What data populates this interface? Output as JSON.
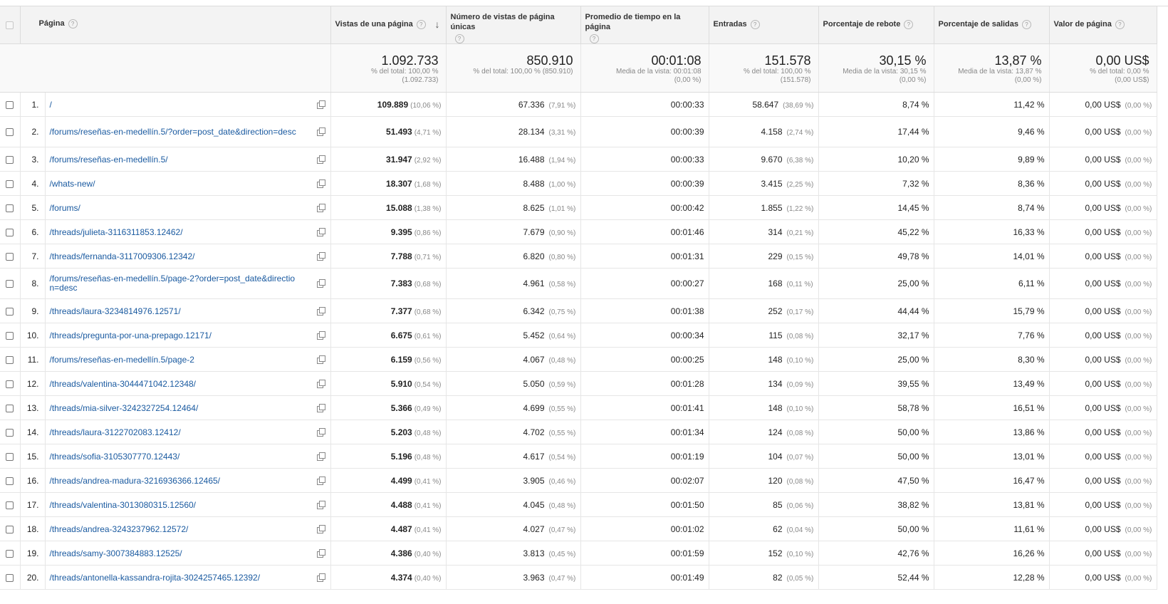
{
  "columns": {
    "pagina": "Página",
    "vistas": "Vistas de una página",
    "unicas": "Número de vistas de página únicas",
    "promedio": "Promedio de tiempo en la página",
    "entradas": "Entradas",
    "rebote": "Porcentaje de rebote",
    "salidas": "Porcentaje de salidas",
    "valor": "Valor de página",
    "help_glyph": "?",
    "sort_glyph": "↓"
  },
  "totals": {
    "vistas": {
      "value": "1.092.733",
      "sub1": "% del total: 100,00 %",
      "sub2": "(1.092.733)"
    },
    "unicas": {
      "value": "850.910",
      "sub1": "% del total: 100,00 % (850.910)",
      "sub2": ""
    },
    "promedio": {
      "value": "00:01:08",
      "sub1": "Media de la vista: 00:01:08",
      "sub2": "(0,00 %)"
    },
    "entradas": {
      "value": "151.578",
      "sub1": "% del total: 100,00 %",
      "sub2": "(151.578)"
    },
    "rebote": {
      "value": "30,15 %",
      "sub1": "Media de la vista: 30,15 %",
      "sub2": "(0,00 %)"
    },
    "salidas": {
      "value": "13,87 %",
      "sub1": "Media de la vista: 13,87 %",
      "sub2": "(0,00 %)"
    },
    "valor": {
      "value": "0,00 US$",
      "sub1": "% del total: 0,00 %",
      "sub2": "(0,00 US$)"
    }
  },
  "rows": [
    {
      "idx": "1.",
      "page": "/",
      "pv": "109.889",
      "pv_pct": "(10,06 %)",
      "upv": "67.336",
      "upv_pct": "(7,91 %)",
      "time": "00:00:33",
      "ent": "58.647",
      "ent_pct": "(38,69 %)",
      "bounce": "8,74 %",
      "exit": "11,42 %",
      "val": "0,00 US$",
      "val_pct": "(0,00 %)"
    },
    {
      "idx": "2.",
      "page": "/forums/reseñas-en-medellín.5/?order=post_date&direction=desc",
      "pv": "51.493",
      "pv_pct": "(4,71 %)",
      "upv": "28.134",
      "upv_pct": "(3,31 %)",
      "time": "00:00:39",
      "ent": "4.158",
      "ent_pct": "(2,74 %)",
      "bounce": "17,44 %",
      "exit": "9,46 %",
      "val": "0,00 US$",
      "val_pct": "(0,00 %)"
    },
    {
      "idx": "3.",
      "page": "/forums/reseñas-en-medellín.5/",
      "pv": "31.947",
      "pv_pct": "(2,92 %)",
      "upv": "16.488",
      "upv_pct": "(1,94 %)",
      "time": "00:00:33",
      "ent": "9.670",
      "ent_pct": "(6,38 %)",
      "bounce": "10,20 %",
      "exit": "9,89 %",
      "val": "0,00 US$",
      "val_pct": "(0,00 %)"
    },
    {
      "idx": "4.",
      "page": "/whats-new/",
      "pv": "18.307",
      "pv_pct": "(1,68 %)",
      "upv": "8.488",
      "upv_pct": "(1,00 %)",
      "time": "00:00:39",
      "ent": "3.415",
      "ent_pct": "(2,25 %)",
      "bounce": "7,32 %",
      "exit": "8,36 %",
      "val": "0,00 US$",
      "val_pct": "(0,00 %)"
    },
    {
      "idx": "5.",
      "page": "/forums/",
      "pv": "15.088",
      "pv_pct": "(1,38 %)",
      "upv": "8.625",
      "upv_pct": "(1,01 %)",
      "time": "00:00:42",
      "ent": "1.855",
      "ent_pct": "(1,22 %)",
      "bounce": "14,45 %",
      "exit": "8,74 %",
      "val": "0,00 US$",
      "val_pct": "(0,00 %)"
    },
    {
      "idx": "6.",
      "page": "/threads/julieta-3116311853.12462/",
      "pv": "9.395",
      "pv_pct": "(0,86 %)",
      "upv": "7.679",
      "upv_pct": "(0,90 %)",
      "time": "00:01:46",
      "ent": "314",
      "ent_pct": "(0,21 %)",
      "bounce": "45,22 %",
      "exit": "16,33 %",
      "val": "0,00 US$",
      "val_pct": "(0,00 %)"
    },
    {
      "idx": "7.",
      "page": "/threads/fernanda-3117009306.12342/",
      "pv": "7.788",
      "pv_pct": "(0,71 %)",
      "upv": "6.820",
      "upv_pct": "(0,80 %)",
      "time": "00:01:31",
      "ent": "229",
      "ent_pct": "(0,15 %)",
      "bounce": "49,78 %",
      "exit": "14,01 %",
      "val": "0,00 US$",
      "val_pct": "(0,00 %)"
    },
    {
      "idx": "8.",
      "page": "/forums/reseñas-en-medellín.5/page-2?order=post_date&direction=desc",
      "pv": "7.383",
      "pv_pct": "(0,68 %)",
      "upv": "4.961",
      "upv_pct": "(0,58 %)",
      "time": "00:00:27",
      "ent": "168",
      "ent_pct": "(0,11 %)",
      "bounce": "25,00 %",
      "exit": "6,11 %",
      "val": "0,00 US$",
      "val_pct": "(0,00 %)"
    },
    {
      "idx": "9.",
      "page": "/threads/laura-3234814976.12571/",
      "pv": "7.377",
      "pv_pct": "(0,68 %)",
      "upv": "6.342",
      "upv_pct": "(0,75 %)",
      "time": "00:01:38",
      "ent": "252",
      "ent_pct": "(0,17 %)",
      "bounce": "44,44 %",
      "exit": "15,79 %",
      "val": "0,00 US$",
      "val_pct": "(0,00 %)"
    },
    {
      "idx": "10.",
      "page": "/threads/pregunta-por-una-prepago.12171/",
      "pv": "6.675",
      "pv_pct": "(0,61 %)",
      "upv": "5.452",
      "upv_pct": "(0,64 %)",
      "time": "00:00:34",
      "ent": "115",
      "ent_pct": "(0,08 %)",
      "bounce": "32,17 %",
      "exit": "7,76 %",
      "val": "0,00 US$",
      "val_pct": "(0,00 %)"
    },
    {
      "idx": "11.",
      "page": "/forums/reseñas-en-medellín.5/page-2",
      "pv": "6.159",
      "pv_pct": "(0,56 %)",
      "upv": "4.067",
      "upv_pct": "(0,48 %)",
      "time": "00:00:25",
      "ent": "148",
      "ent_pct": "(0,10 %)",
      "bounce": "25,00 %",
      "exit": "8,30 %",
      "val": "0,00 US$",
      "val_pct": "(0,00 %)"
    },
    {
      "idx": "12.",
      "page": "/threads/valentina-3044471042.12348/",
      "pv": "5.910",
      "pv_pct": "(0,54 %)",
      "upv": "5.050",
      "upv_pct": "(0,59 %)",
      "time": "00:01:28",
      "ent": "134",
      "ent_pct": "(0,09 %)",
      "bounce": "39,55 %",
      "exit": "13,49 %",
      "val": "0,00 US$",
      "val_pct": "(0,00 %)"
    },
    {
      "idx": "13.",
      "page": "/threads/mia-silver-3242327254.12464/",
      "pv": "5.366",
      "pv_pct": "(0,49 %)",
      "upv": "4.699",
      "upv_pct": "(0,55 %)",
      "time": "00:01:41",
      "ent": "148",
      "ent_pct": "(0,10 %)",
      "bounce": "58,78 %",
      "exit": "16,51 %",
      "val": "0,00 US$",
      "val_pct": "(0,00 %)"
    },
    {
      "idx": "14.",
      "page": "/threads/laura-3122702083.12412/",
      "pv": "5.203",
      "pv_pct": "(0,48 %)",
      "upv": "4.702",
      "upv_pct": "(0,55 %)",
      "time": "00:01:34",
      "ent": "124",
      "ent_pct": "(0,08 %)",
      "bounce": "50,00 %",
      "exit": "13,86 %",
      "val": "0,00 US$",
      "val_pct": "(0,00 %)"
    },
    {
      "idx": "15.",
      "page": "/threads/sofia-3105307770.12443/",
      "pv": "5.196",
      "pv_pct": "(0,48 %)",
      "upv": "4.617",
      "upv_pct": "(0,54 %)",
      "time": "00:01:19",
      "ent": "104",
      "ent_pct": "(0,07 %)",
      "bounce": "50,00 %",
      "exit": "13,01 %",
      "val": "0,00 US$",
      "val_pct": "(0,00 %)"
    },
    {
      "idx": "16.",
      "page": "/threads/andrea-madura-3216936366.12465/",
      "pv": "4.499",
      "pv_pct": "(0,41 %)",
      "upv": "3.905",
      "upv_pct": "(0,46 %)",
      "time": "00:02:07",
      "ent": "120",
      "ent_pct": "(0,08 %)",
      "bounce": "47,50 %",
      "exit": "16,47 %",
      "val": "0,00 US$",
      "val_pct": "(0,00 %)"
    },
    {
      "idx": "17.",
      "page": "/threads/valentina-3013080315.12560/",
      "pv": "4.488",
      "pv_pct": "(0,41 %)",
      "upv": "4.045",
      "upv_pct": "(0,48 %)",
      "time": "00:01:50",
      "ent": "85",
      "ent_pct": "(0,06 %)",
      "bounce": "38,82 %",
      "exit": "13,81 %",
      "val": "0,00 US$",
      "val_pct": "(0,00 %)"
    },
    {
      "idx": "18.",
      "page": "/threads/andrea-3243237962.12572/",
      "pv": "4.487",
      "pv_pct": "(0,41 %)",
      "upv": "4.027",
      "upv_pct": "(0,47 %)",
      "time": "00:01:02",
      "ent": "62",
      "ent_pct": "(0,04 %)",
      "bounce": "50,00 %",
      "exit": "11,61 %",
      "val": "0,00 US$",
      "val_pct": "(0,00 %)"
    },
    {
      "idx": "19.",
      "page": "/threads/samy-3007384883.12525/",
      "pv": "4.386",
      "pv_pct": "(0,40 %)",
      "upv": "3.813",
      "upv_pct": "(0,45 %)",
      "time": "00:01:59",
      "ent": "152",
      "ent_pct": "(0,10 %)",
      "bounce": "42,76 %",
      "exit": "16,26 %",
      "val": "0,00 US$",
      "val_pct": "(0,00 %)"
    },
    {
      "idx": "20.",
      "page": "/threads/antonella-kassandra-rojita-3024257465.12392/",
      "pv": "4.374",
      "pv_pct": "(0,40 %)",
      "upv": "3.963",
      "upv_pct": "(0,47 %)",
      "time": "00:01:49",
      "ent": "82",
      "ent_pct": "(0,05 %)",
      "bounce": "52,44 %",
      "exit": "12,28 %",
      "val": "0,00 US$",
      "val_pct": "(0,00 %)"
    }
  ]
}
